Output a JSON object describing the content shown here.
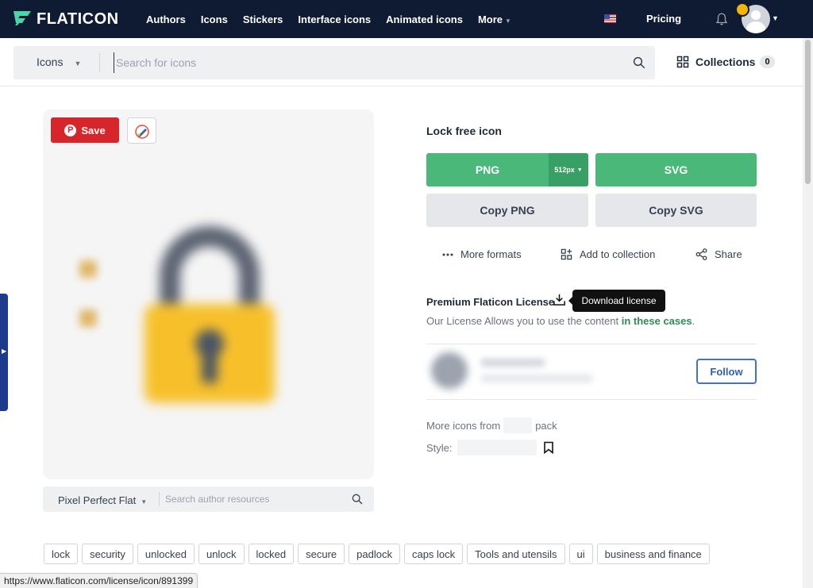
{
  "nav": {
    "logo_text": "FLATICON",
    "links": [
      "Authors",
      "Icons",
      "Stickers",
      "Interface icons",
      "Animated icons",
      "More"
    ],
    "pricing": "Pricing",
    "flag_icon": "us-flag-icon"
  },
  "search": {
    "type_label": "Icons",
    "placeholder": "Search for icons",
    "value": ""
  },
  "collections": {
    "label": "Collections",
    "count": "0"
  },
  "preview": {
    "save_label": "Save",
    "author_name": "Pixel Perfect Flat",
    "author_search_placeholder": "Search author resources"
  },
  "detail": {
    "title": "Lock free icon",
    "png_label": "PNG",
    "png_size": "512px",
    "svg_label": "SVG",
    "copy_png_label": "Copy PNG",
    "copy_svg_label": "Copy SVG",
    "more_formats": "More formats",
    "add_to_collection": "Add to collection",
    "share": "Share",
    "license_title": "Premium Flaticon License",
    "tooltip": "Download license",
    "license_text": "Our License Allows you to use the content",
    "license_link": "in these cases",
    "license_period": ".",
    "follow_label": "Follow",
    "more_icons_prefix": "More icons from",
    "more_icons_suffix": "pack",
    "style_label": "Style:"
  },
  "tags": [
    "lock",
    "security",
    "unlocked",
    "unlock",
    "locked",
    "secure",
    "padlock",
    "caps lock",
    "Tools and utensils",
    "ui",
    "business and finance"
  ],
  "statusbar": {
    "url": "https://www.flaticon.com/license/icon/891399"
  },
  "colors": {
    "nav_bg": "#0f1a33",
    "accent_green": "#4ab879",
    "save_red": "#d7262b",
    "follow_blue": "#2f5fb3"
  }
}
